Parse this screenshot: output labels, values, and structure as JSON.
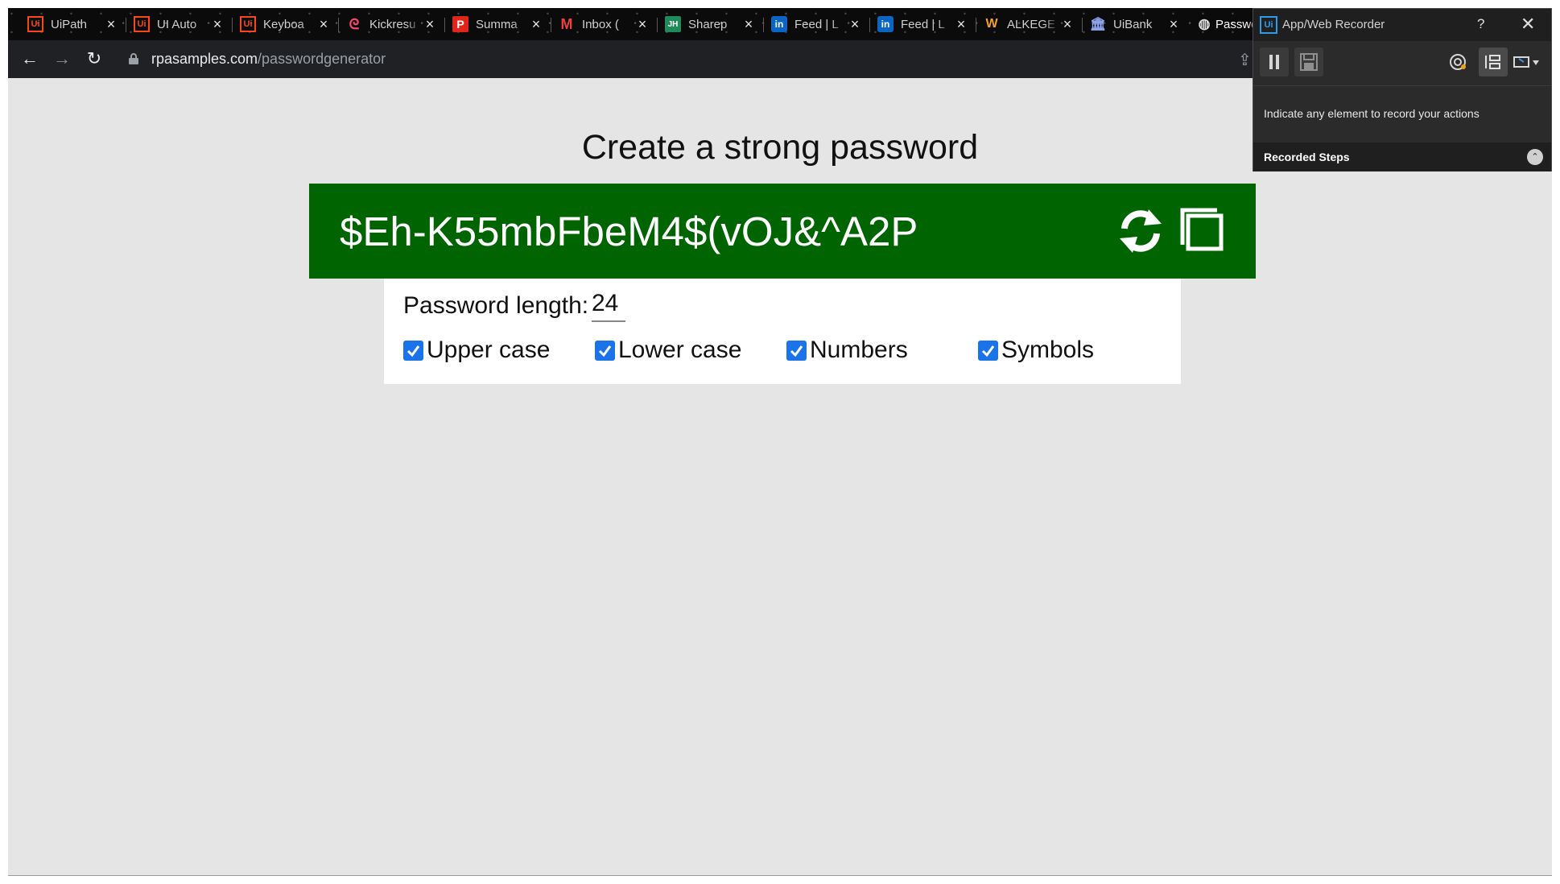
{
  "browser": {
    "tabs": [
      {
        "title": "UiPath",
        "icon": "uipath-icon"
      },
      {
        "title": "UI Auto",
        "icon": "uipath-icon"
      },
      {
        "title": "Keyboa",
        "icon": "uipath-icon"
      },
      {
        "title": "Kickresu",
        "icon": "kickresume-icon"
      },
      {
        "title": "Summa",
        "icon": "pdf-icon"
      },
      {
        "title": "Inbox (",
        "icon": "gmail-icon"
      },
      {
        "title": "Sharep",
        "icon": "jh-icon"
      },
      {
        "title": "Feed | L",
        "icon": "linkedin-icon"
      },
      {
        "title": "Feed | L",
        "icon": "linkedin-icon"
      },
      {
        "title": "ALKEGE",
        "icon": "alkege-icon"
      },
      {
        "title": "UiBank",
        "icon": "bank-icon"
      },
      {
        "title": "Passwo",
        "icon": "globe-icon"
      }
    ],
    "tab_close": "×",
    "address": {
      "host": "rpasamples.com",
      "path": "/passwordgenerator"
    }
  },
  "page": {
    "title": "Create a strong password",
    "password": "$Eh-K55mbFbeM4$(vOJ&^A2P",
    "length_label": "Password length:",
    "length_value": "24",
    "options": [
      {
        "label": "Upper case",
        "checked": true
      },
      {
        "label": "Lower case",
        "checked": true
      },
      {
        "label": "Numbers",
        "checked": true
      },
      {
        "label": "Symbols",
        "checked": true
      }
    ],
    "colors": {
      "password_bg": "#006400",
      "checkbox": "#1a73e8",
      "page_bg": "#e5e5e5"
    }
  },
  "recorder": {
    "logo": "Ui",
    "title": "App/Web Recorder",
    "help": "?",
    "close": "✕",
    "message": "Indicate any element to record your actions",
    "steps_label": "Recorded Steps",
    "collapse": "⌃"
  }
}
